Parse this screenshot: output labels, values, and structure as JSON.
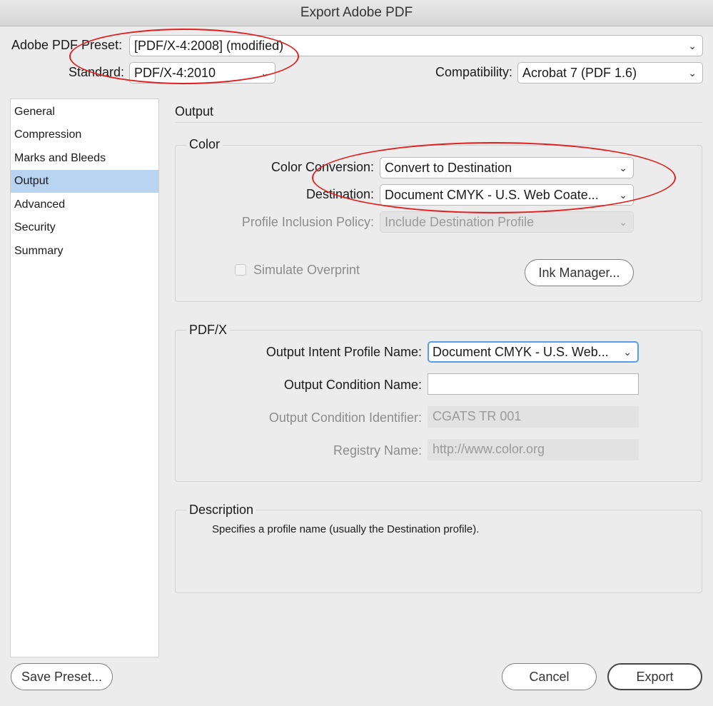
{
  "window": {
    "title": "Export Adobe PDF"
  },
  "header": {
    "preset_label": "Adobe PDF Preset:",
    "preset_value": "[PDF/X-4:2008] (modified)",
    "standard_label": "Standard:",
    "standard_value": "PDF/X-4:2010",
    "compat_label": "Compatibility:",
    "compat_value": "Acrobat 7 (PDF 1.6)"
  },
  "sidebar": {
    "items": [
      {
        "label": "General"
      },
      {
        "label": "Compression"
      },
      {
        "label": "Marks and Bleeds"
      },
      {
        "label": "Output",
        "active": true
      },
      {
        "label": "Advanced"
      },
      {
        "label": "Security"
      },
      {
        "label": "Summary"
      }
    ]
  },
  "main": {
    "section_title": "Output",
    "color": {
      "title": "Color",
      "conversion_label": "Color Conversion:",
      "conversion_value": "Convert to Destination",
      "destination_label": "Destination:",
      "destination_value": "Document CMYK - U.S. Web Coate...",
      "profile_label": "Profile Inclusion Policy:",
      "profile_value": "Include Destination Profile",
      "simulate_label": "Simulate Overprint",
      "ink_button": "Ink Manager..."
    },
    "pdfx": {
      "title": "PDF/X",
      "intent_label": "Output Intent Profile Name:",
      "intent_value": "Document CMYK - U.S. Web...",
      "condition_label": "Output Condition Name:",
      "condition_value": "",
      "identifier_label": "Output Condition Identifier:",
      "identifier_value": "CGATS TR 001",
      "registry_label": "Registry Name:",
      "registry_value": "http://www.color.org"
    },
    "description": {
      "title": "Description",
      "text": "Specifies a profile name (usually the Destination profile)."
    }
  },
  "footer": {
    "save_preset": "Save Preset...",
    "cancel": "Cancel",
    "export": "Export"
  },
  "colors": {
    "annotation": "#e02020",
    "selection": "#b9d4f1",
    "focus": "#5a9bea"
  },
  "icons": {
    "dropdown": "chevron-down-icon"
  }
}
